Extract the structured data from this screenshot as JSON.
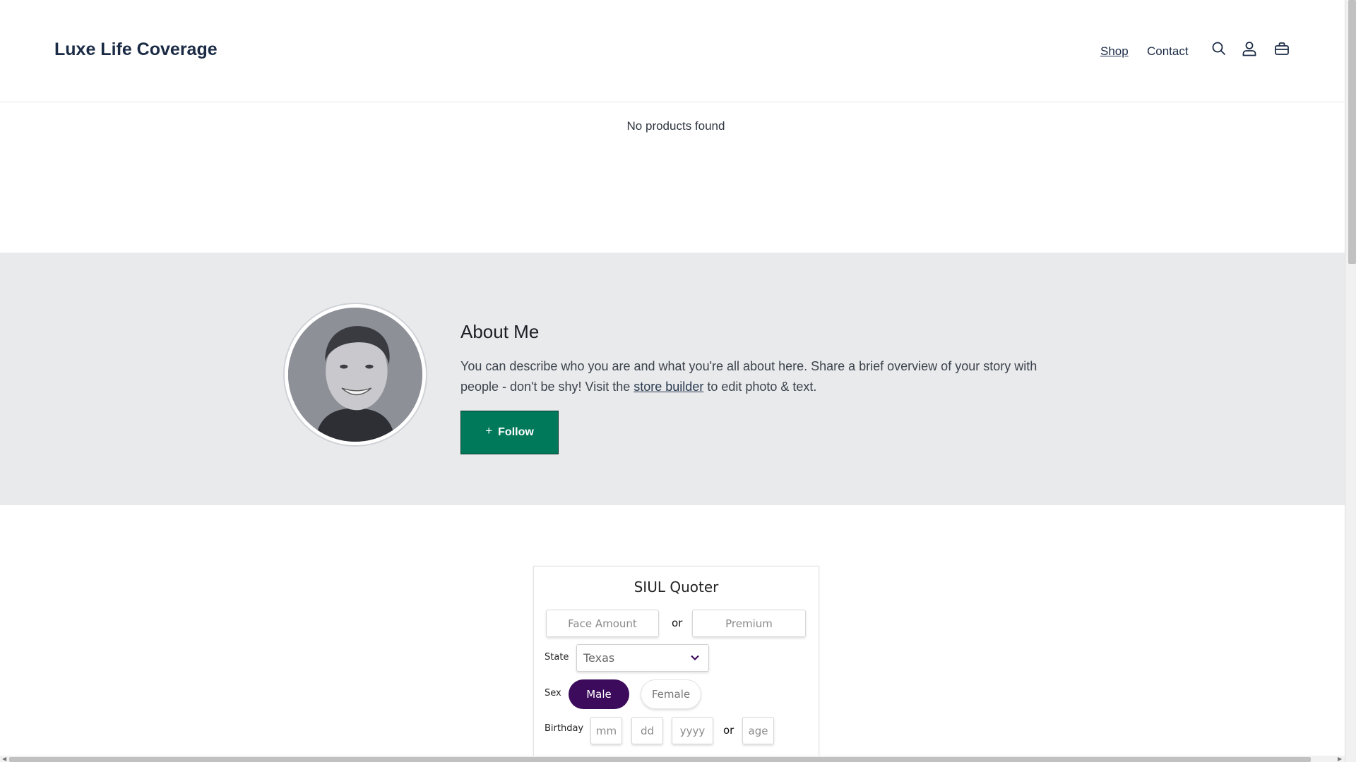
{
  "header": {
    "logo": "Luxe Life Coverage",
    "nav": {
      "shop": "Shop",
      "contact": "Contact"
    },
    "icons": [
      "search-icon",
      "account-icon",
      "cart-icon"
    ]
  },
  "products": {
    "empty_message": "No products found"
  },
  "about": {
    "title": "About Me",
    "text_before_link": "You can describe who you are and what you're all about here. Share a brief overview of your story with people - don't be shy! Visit the ",
    "link_text": "store builder",
    "text_after_link": " to edit photo & text.",
    "follow_plus": "+",
    "follow_label": "Follow",
    "follow_color": "#00785a"
  },
  "quoter": {
    "title": "SIUL Quoter",
    "face_amount_placeholder": "Face Amount",
    "or_1": "or",
    "premium_placeholder": "Premium",
    "state_label": "State",
    "state_value": "Texas",
    "sex_label": "Sex",
    "sex_male": "Male",
    "sex_female": "Female",
    "sex_selected": "Male",
    "birthday_label": "Birthday",
    "mm_placeholder": "mm",
    "dd_placeholder": "dd",
    "yyyy_placeholder": "yyyy",
    "or_2": "or",
    "age_placeholder": "age",
    "active_color": "#3c0b5b"
  }
}
